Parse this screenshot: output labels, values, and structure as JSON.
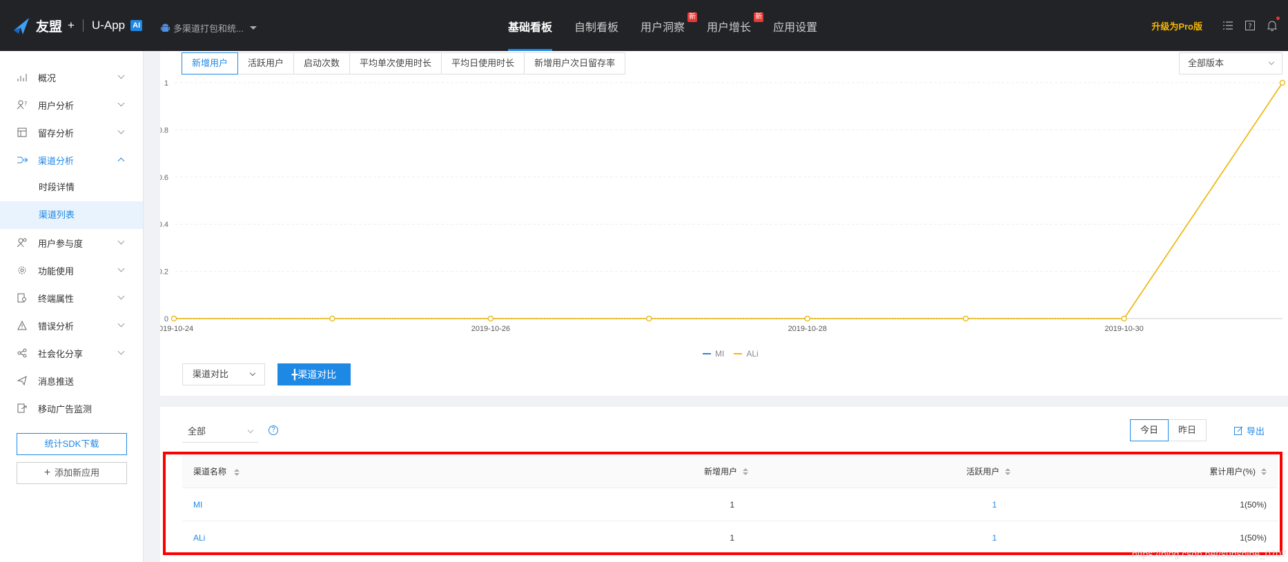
{
  "header": {
    "brand": "友盟",
    "plus": "+",
    "product": "U-App",
    "ai": "AI",
    "app_selector": "多渠道打包和统...",
    "nav": [
      {
        "label": "基础看板",
        "active": true,
        "badge": ""
      },
      {
        "label": "自制看板",
        "active": false,
        "badge": ""
      },
      {
        "label": "用户洞察",
        "active": false,
        "badge": "新"
      },
      {
        "label": "用户增长",
        "active": false,
        "badge": "新"
      },
      {
        "label": "应用设置",
        "active": false,
        "badge": ""
      }
    ],
    "upgrade": "升级为Pro版"
  },
  "sidebar": {
    "items": [
      {
        "label": "概况",
        "icon": "overview-icon"
      },
      {
        "label": "用户分析",
        "icon": "user-analysis-icon"
      },
      {
        "label": "留存分析",
        "icon": "retention-icon"
      },
      {
        "label": "渠道分析",
        "icon": "channel-icon"
      },
      {
        "label": "时段详情"
      },
      {
        "label": "渠道列表"
      },
      {
        "label": "用户参与度",
        "icon": "engagement-icon"
      },
      {
        "label": "功能使用",
        "icon": "feature-icon"
      },
      {
        "label": "终端属性",
        "icon": "device-icon"
      },
      {
        "label": "错误分析",
        "icon": "warning-icon"
      },
      {
        "label": "社会化分享",
        "icon": "share-icon"
      },
      {
        "label": "消息推送",
        "icon": "push-icon"
      },
      {
        "label": "移动广告监测",
        "icon": "ad-monitor-icon"
      }
    ],
    "sdk_button": "统计SDK下载",
    "add_app_button": "添加新应用"
  },
  "chart_panel": {
    "tabs": [
      "新增用户",
      "活跃用户",
      "启动次数",
      "平均单次使用时长",
      "平均日使用时长",
      "新增用户次日留存率"
    ],
    "active_tab": 0,
    "version_select": "全部版本",
    "compare_select": "渠道对比",
    "add_compare_button": "╋渠道对比"
  },
  "chart_data": {
    "type": "line",
    "x": [
      "2019-10-24",
      "2019-10-25",
      "2019-10-26",
      "2019-10-27",
      "2019-10-28",
      "2019-10-29",
      "2019-10-30",
      "2019-10-31"
    ],
    "xticks": [
      "2019-10-24",
      "2019-10-26",
      "2019-10-28",
      "2019-10-30"
    ],
    "yticks": [
      "0",
      "0.2",
      "0.4",
      "0.6",
      "0.8",
      "1"
    ],
    "ylim": [
      0,
      1
    ],
    "grid": true,
    "legend_position": "bottom-center",
    "series": [
      {
        "name": "MI",
        "color": "#1e88e5",
        "values": [
          0,
          0,
          0,
          0,
          0,
          0,
          0,
          1
        ]
      },
      {
        "name": "ALi",
        "color": "#f5b800",
        "values": [
          0,
          0,
          0,
          0,
          0,
          0,
          0,
          1
        ]
      }
    ]
  },
  "table_panel": {
    "filter_select": "全部",
    "help": "?",
    "day_buttons": [
      "今日",
      "昨日"
    ],
    "export": "导出",
    "columns": [
      "渠道名称",
      "新增用户",
      "活跃用户",
      "累计用户(%)"
    ],
    "rows": [
      [
        "MI",
        "1",
        "1",
        "1(50%)"
      ],
      [
        "ALi",
        "1",
        "1",
        "1(50%)"
      ]
    ]
  },
  "watermark": "https://blog.csdn.net/sunshine_0707"
}
